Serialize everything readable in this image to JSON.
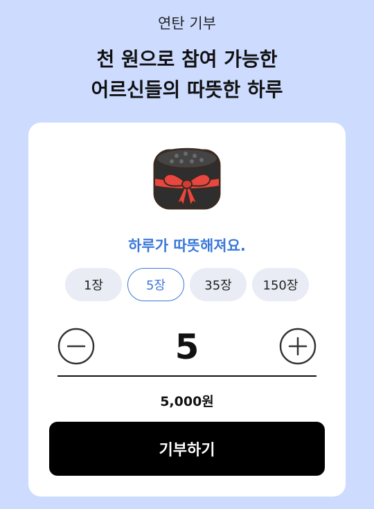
{
  "header": {
    "eyebrow": "연탄 기부",
    "headline_line1": "천 원으로 참여 가능한",
    "headline_line2": "어르신들의 따뜻한 하루"
  },
  "card": {
    "gift_icon": "briquette-gift-with-red-bow-icon",
    "tagline": "하루가 따뜻해져요.",
    "quantity_options": [
      {
        "label": "1장",
        "selected": false
      },
      {
        "label": "5장",
        "selected": true
      },
      {
        "label": "35장",
        "selected": false
      },
      {
        "label": "150장",
        "selected": false
      }
    ],
    "stepper": {
      "minus_icon": "minus-circle-icon",
      "plus_icon": "plus-circle-icon",
      "value": "5"
    },
    "amount": "5,000원",
    "donate_label": "기부하기"
  },
  "colors": {
    "background": "#cddbff",
    "accent": "#3a78d8",
    "chip_bg": "#e9ecf5",
    "button_bg": "#000000",
    "bow_red": "#e8473f",
    "briquette": "#2e2e2e"
  }
}
